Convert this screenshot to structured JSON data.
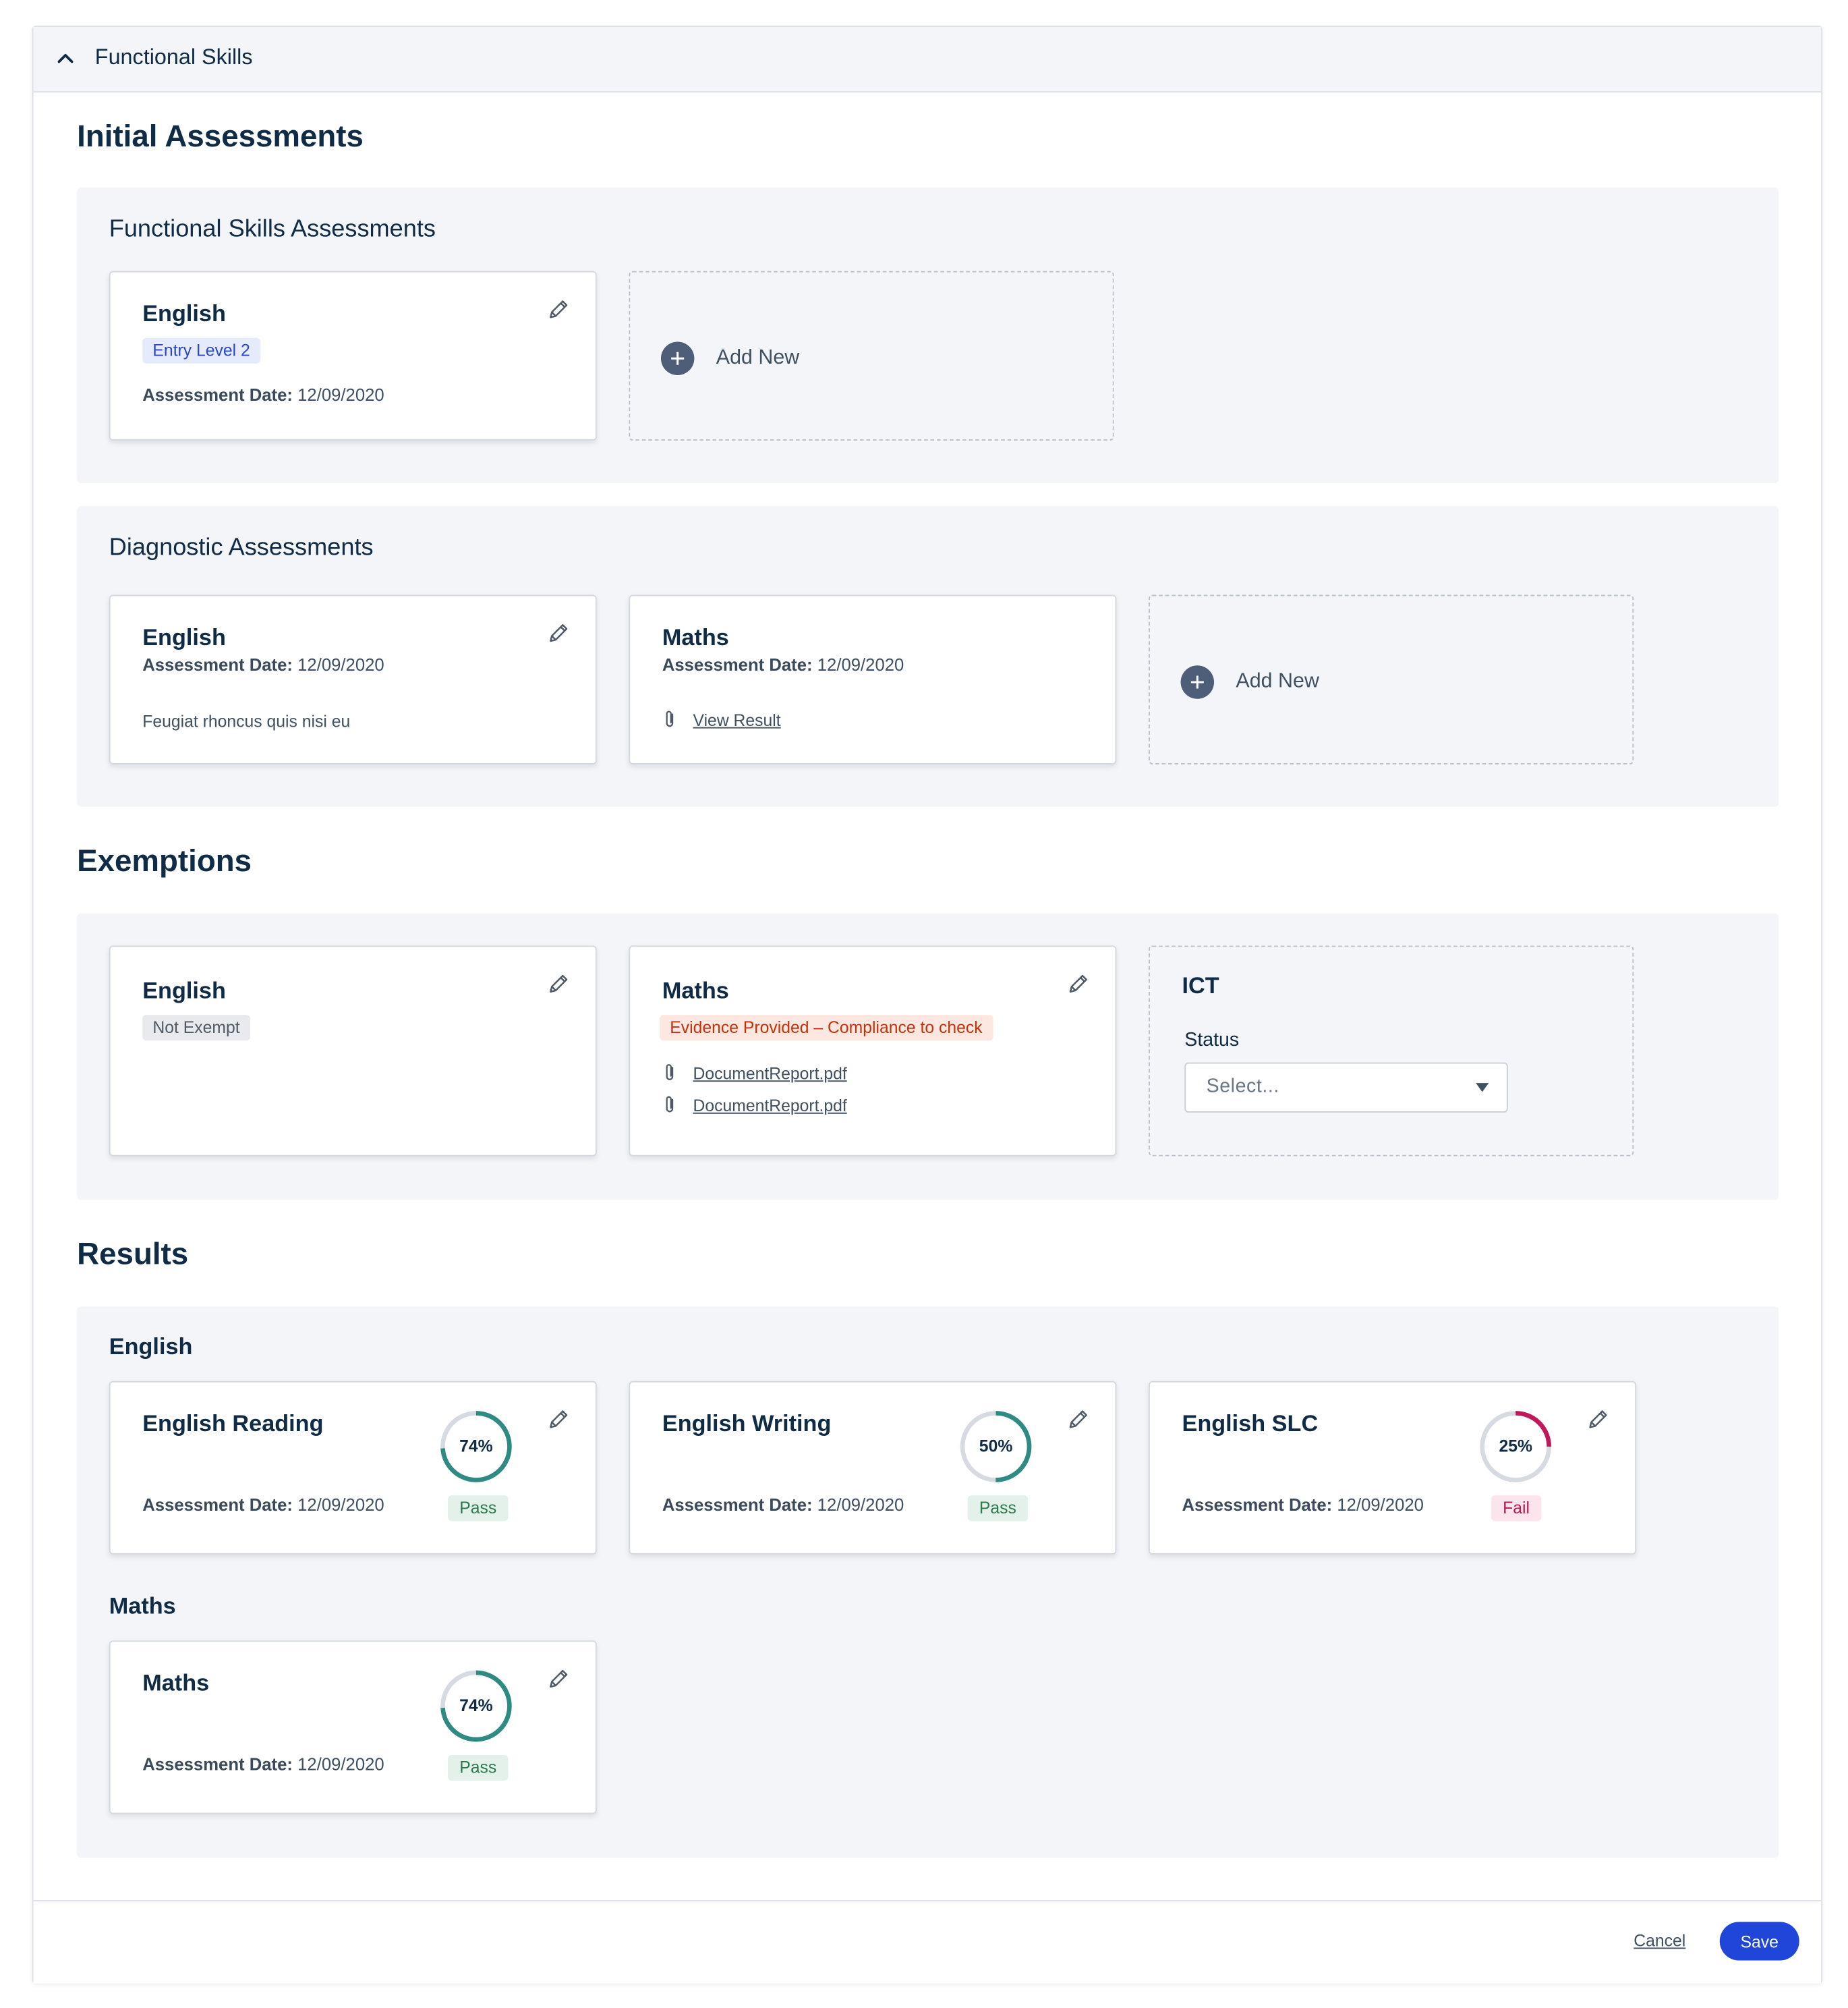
{
  "panel": {
    "title": "Functional Skills"
  },
  "initial": {
    "heading": "Initial Assessments",
    "functional": {
      "heading": "Functional Skills Assessments",
      "english": {
        "title": "English",
        "tag": "Entry Level 2",
        "date_label": "Assessment Date:",
        "date": "12/09/2020"
      },
      "add_new": "Add New"
    },
    "diagnostic": {
      "heading": "Diagnostic Assessments",
      "english": {
        "title": "English",
        "date_label": "Assessment Date:",
        "date": "12/09/2020",
        "note": "Feugiat rhoncus quis nisi eu"
      },
      "maths": {
        "title": "Maths",
        "date_label": "Assessment Date:",
        "date": "12/09/2020",
        "link": "View Result"
      },
      "add_new": "Add New"
    }
  },
  "exemptions": {
    "heading": "Exemptions",
    "english": {
      "title": "English",
      "tag": "Not Exempt"
    },
    "maths": {
      "title": "Maths",
      "tag": "Evidence Provided – Compliance to check",
      "files": [
        "DocumentReport.pdf",
        "DocumentReport.pdf"
      ]
    },
    "ict": {
      "title": "ICT",
      "status_label": "Status",
      "select_placeholder": "Select..."
    }
  },
  "results": {
    "heading": "Results",
    "english": {
      "heading": "English",
      "cards": [
        {
          "title": "English Reading",
          "percent": 74,
          "percent_label": "74%",
          "result": "Pass",
          "date_label": "Assessment Date:",
          "date": "12/09/2020"
        },
        {
          "title": "English Writing",
          "percent": 50,
          "percent_label": "50%",
          "result": "Pass",
          "date_label": "Assessment Date:",
          "date": "12/09/2020"
        },
        {
          "title": "English SLC",
          "percent": 25,
          "percent_label": "25%",
          "result": "Fail",
          "date_label": "Assessment Date:",
          "date": "12/09/2020"
        }
      ]
    },
    "maths": {
      "heading": "Maths",
      "cards": [
        {
          "title": "Maths",
          "percent": 74,
          "percent_label": "74%",
          "result": "Pass",
          "date_label": "Assessment Date:",
          "date": "12/09/2020"
        }
      ]
    }
  },
  "footer": {
    "cancel": "Cancel",
    "save": "Save"
  },
  "colors": {
    "pass_ring": "#2e8b84",
    "fail_ring": "#c2185b",
    "ring_track": "#d5dbe1",
    "primary": "#1f46d9"
  },
  "icons": {
    "collapse": "chevron-up-icon",
    "edit": "pencil-icon",
    "add": "plus-icon",
    "attachment": "paperclip-icon",
    "dropdown": "caret-down-icon"
  }
}
